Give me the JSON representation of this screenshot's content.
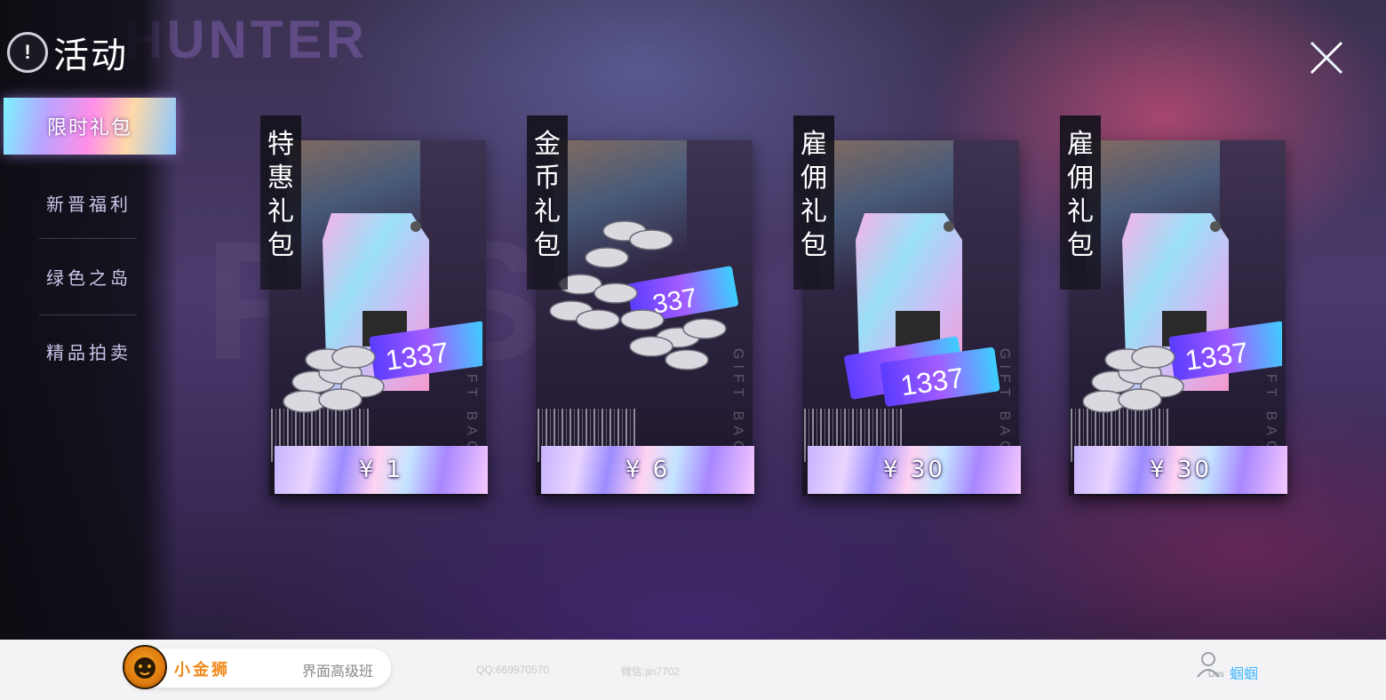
{
  "header": {
    "title": "活动",
    "badge": "!"
  },
  "background": {
    "watermark_text": "HUNTER"
  },
  "sidebar": {
    "active": {
      "label": "限时礼包"
    },
    "items": [
      {
        "label": "新晋福利"
      },
      {
        "label": "绿色之岛"
      },
      {
        "label": "精品拍卖"
      }
    ]
  },
  "cards": [
    {
      "tag": "特惠礼包",
      "price": "¥ 1",
      "contents": "coffee-bag-coins-tickets",
      "ticket_label": "1337",
      "watermark": "GIFT BAG"
    },
    {
      "tag": "金币礼包",
      "price": "¥ 6",
      "contents": "coins-tickets",
      "ticket_label": "1337",
      "watermark": "GIFT BAG"
    },
    {
      "tag": "雇佣礼包",
      "price": "¥ 30",
      "contents": "coffee-bag-tickets",
      "ticket_label": "1337",
      "watermark": "GIFT BAG"
    },
    {
      "tag": "雇佣礼包",
      "price": "¥ 30",
      "contents": "coffee-bag-coins-tickets",
      "ticket_label": "1337",
      "watermark": "GIFT BAG"
    }
  ],
  "footer": {
    "brand_name": "小金狮",
    "course": "界面高级班",
    "qq": "QQ:669970570",
    "wechat": "微信:jin7702",
    "user_tag": "Des",
    "user_name": "蝈蝈"
  },
  "colors": {
    "active_tab": "#b9a4ff",
    "brand": "#f08a1c",
    "user_name": "#3db7ff"
  }
}
